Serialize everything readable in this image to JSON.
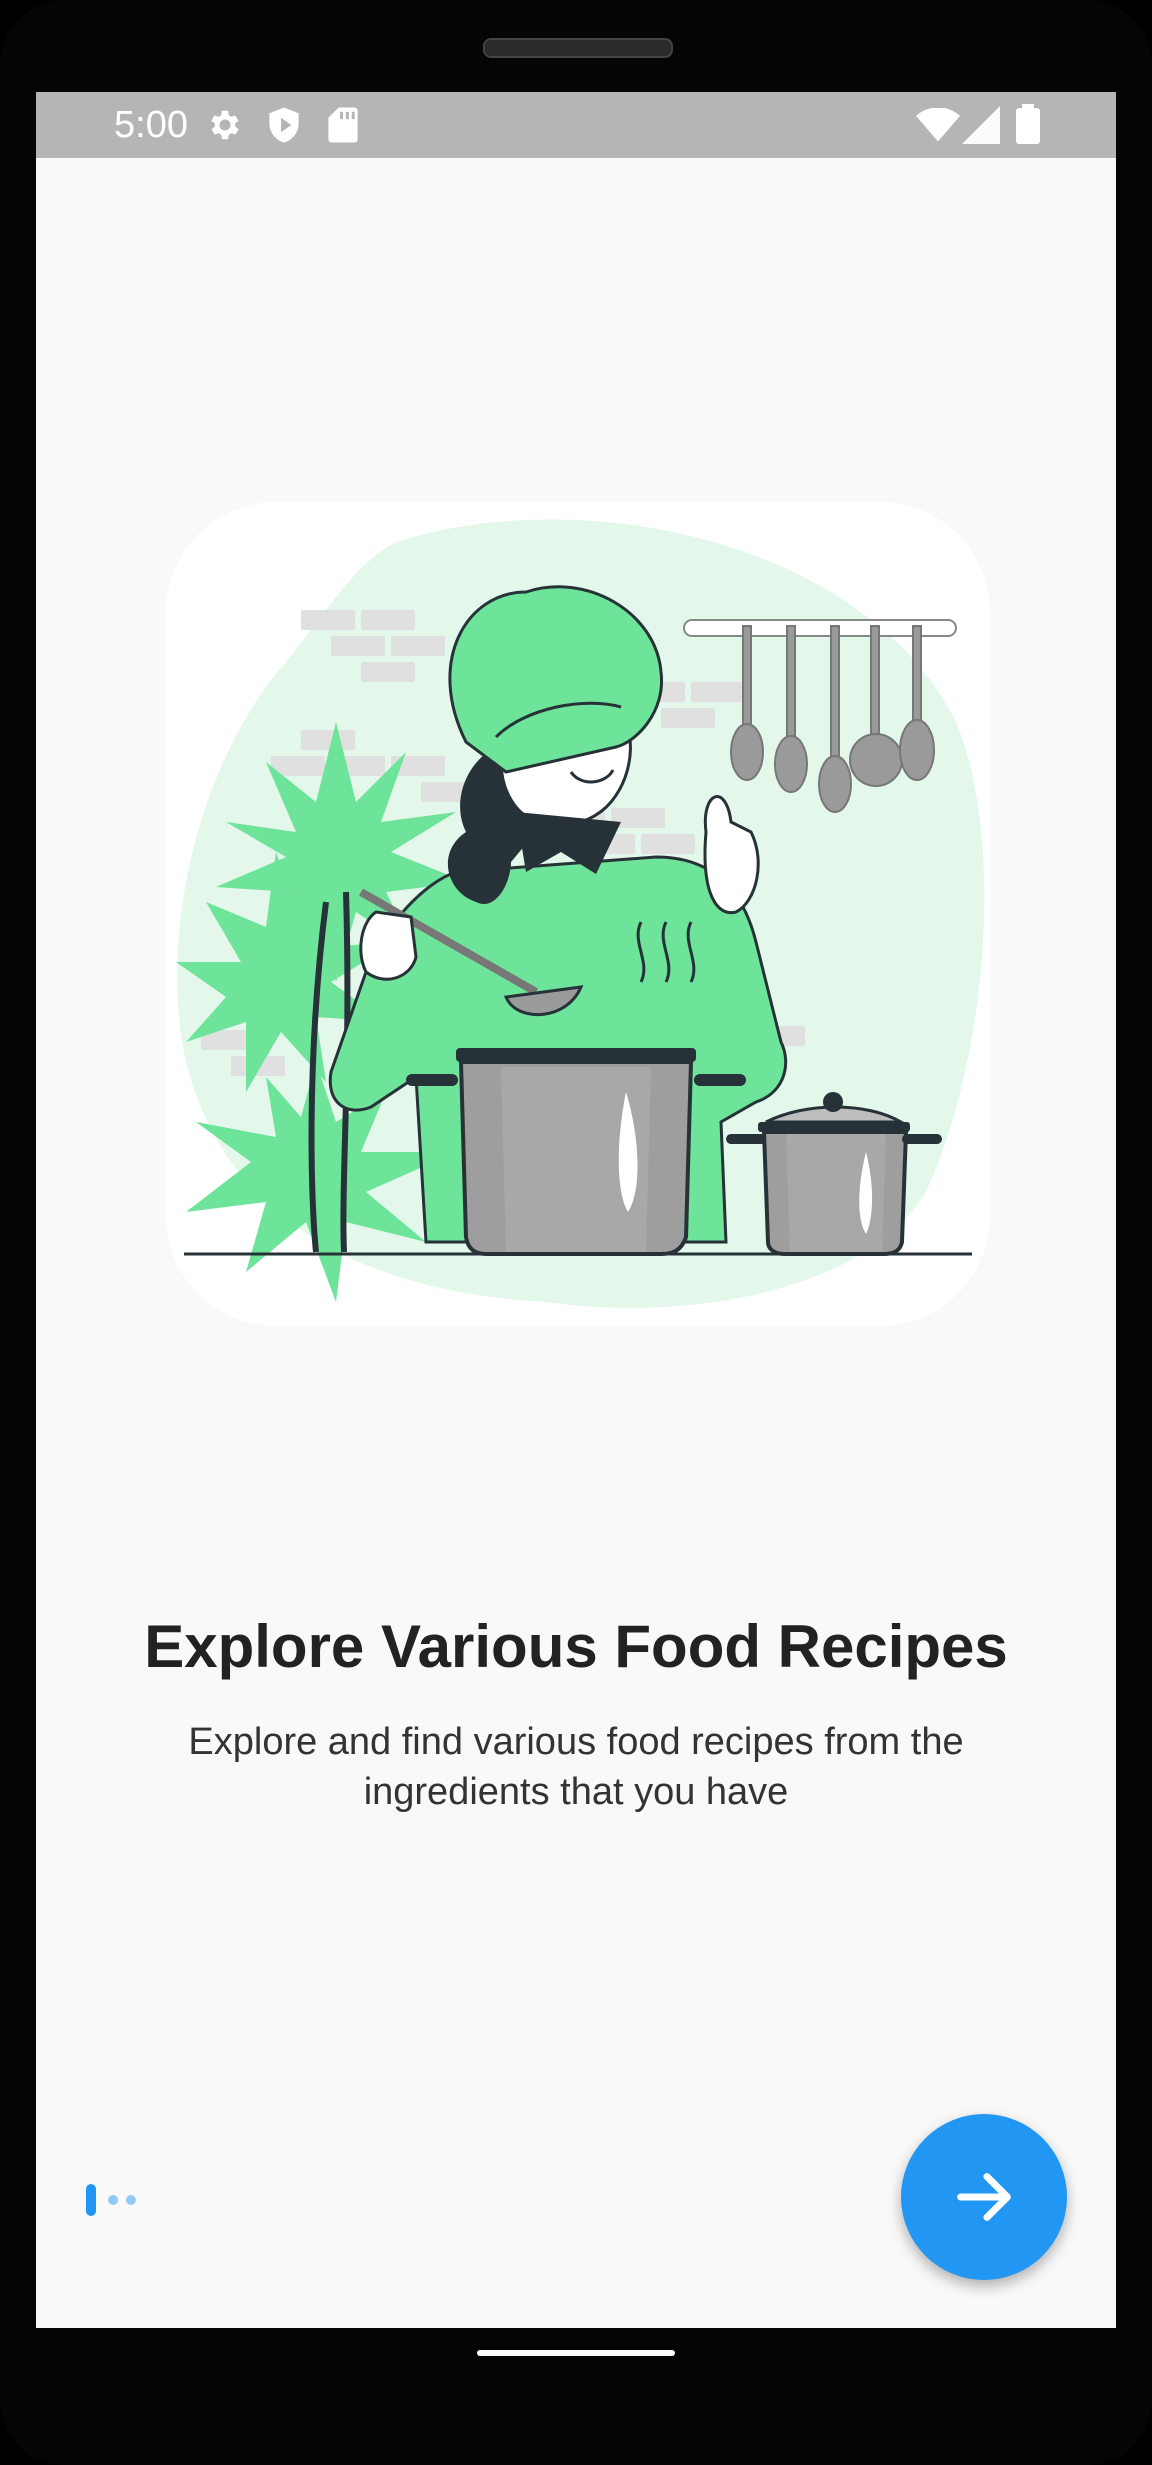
{
  "status_bar": {
    "time": "5:00",
    "left_icons": [
      "gear-icon",
      "shield-icon",
      "sd-card-icon"
    ],
    "right_icons": [
      "wifi-icon",
      "signal-icon",
      "battery-icon"
    ]
  },
  "onboarding": {
    "title": "Explore Various Food Recipes",
    "description": "Explore and find various food recipes from the ingredients that you have",
    "page_indicator": {
      "current": 1,
      "total": 3
    },
    "next_button_icon": "arrow-right-icon"
  },
  "colors": {
    "accent": "#2196f3",
    "illustration_green": "#6ee39a",
    "illustration_blob": "#e3f8ea",
    "text_primary": "#222222"
  }
}
